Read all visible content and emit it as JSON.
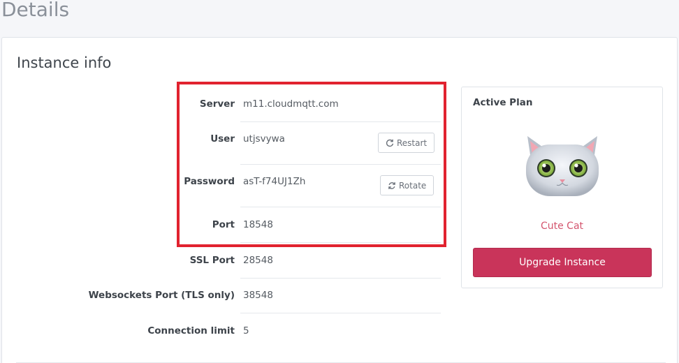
{
  "page": {
    "title": "Details"
  },
  "instance": {
    "title": "Instance info",
    "rows": [
      {
        "label": "Server",
        "value": "m11.cloudmqtt.com"
      },
      {
        "label": "User",
        "value": "utjsvywa",
        "button": "Restart"
      },
      {
        "label": "Password",
        "value": "asT-f74UJ1Zh",
        "button": "Rotate"
      },
      {
        "label": "Port",
        "value": "18548"
      },
      {
        "label": "SSL Port",
        "value": "28548"
      },
      {
        "label": "Websockets Port (TLS only)",
        "value": "38548"
      },
      {
        "label": "Connection limit",
        "value": "5"
      }
    ]
  },
  "plan": {
    "title": "Active Plan",
    "name": "Cute Cat",
    "upgrade_label": "Upgrade Instance",
    "icon": "cat-icon"
  },
  "colors": {
    "highlight": "#e1222f",
    "accent": "#c9345a",
    "plan_name": "#d4556e"
  }
}
